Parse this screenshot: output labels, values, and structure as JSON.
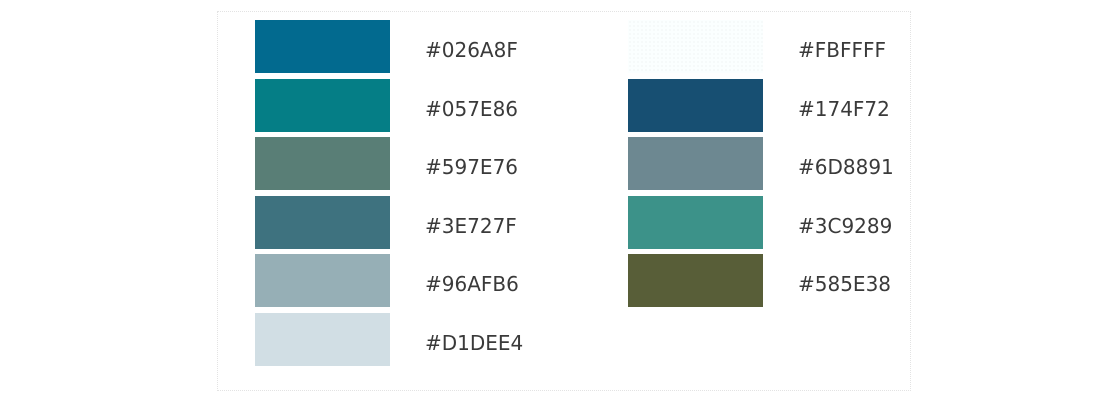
{
  "palette": {
    "left_column": [
      {
        "hex": "#026A8F",
        "color": "#026A8F"
      },
      {
        "hex": "#057E86",
        "color": "#057E86"
      },
      {
        "hex": "#597E76",
        "color": "#597E76"
      },
      {
        "hex": "#3E727F",
        "color": "#3E727F"
      },
      {
        "hex": "#96AFB6",
        "color": "#96AFB6"
      },
      {
        "hex": "#D1DEE4",
        "color": "#D1DEE4"
      }
    ],
    "right_column": [
      {
        "hex": "#FBFFFF",
        "color": "#FBFFFF"
      },
      {
        "hex": "#174F72",
        "color": "#174F72"
      },
      {
        "hex": "#6D8891",
        "color": "#6D8891"
      },
      {
        "hex": "#3C9289",
        "color": "#3C9289"
      },
      {
        "hex": "#585E38",
        "color": "#585E38"
      }
    ]
  }
}
